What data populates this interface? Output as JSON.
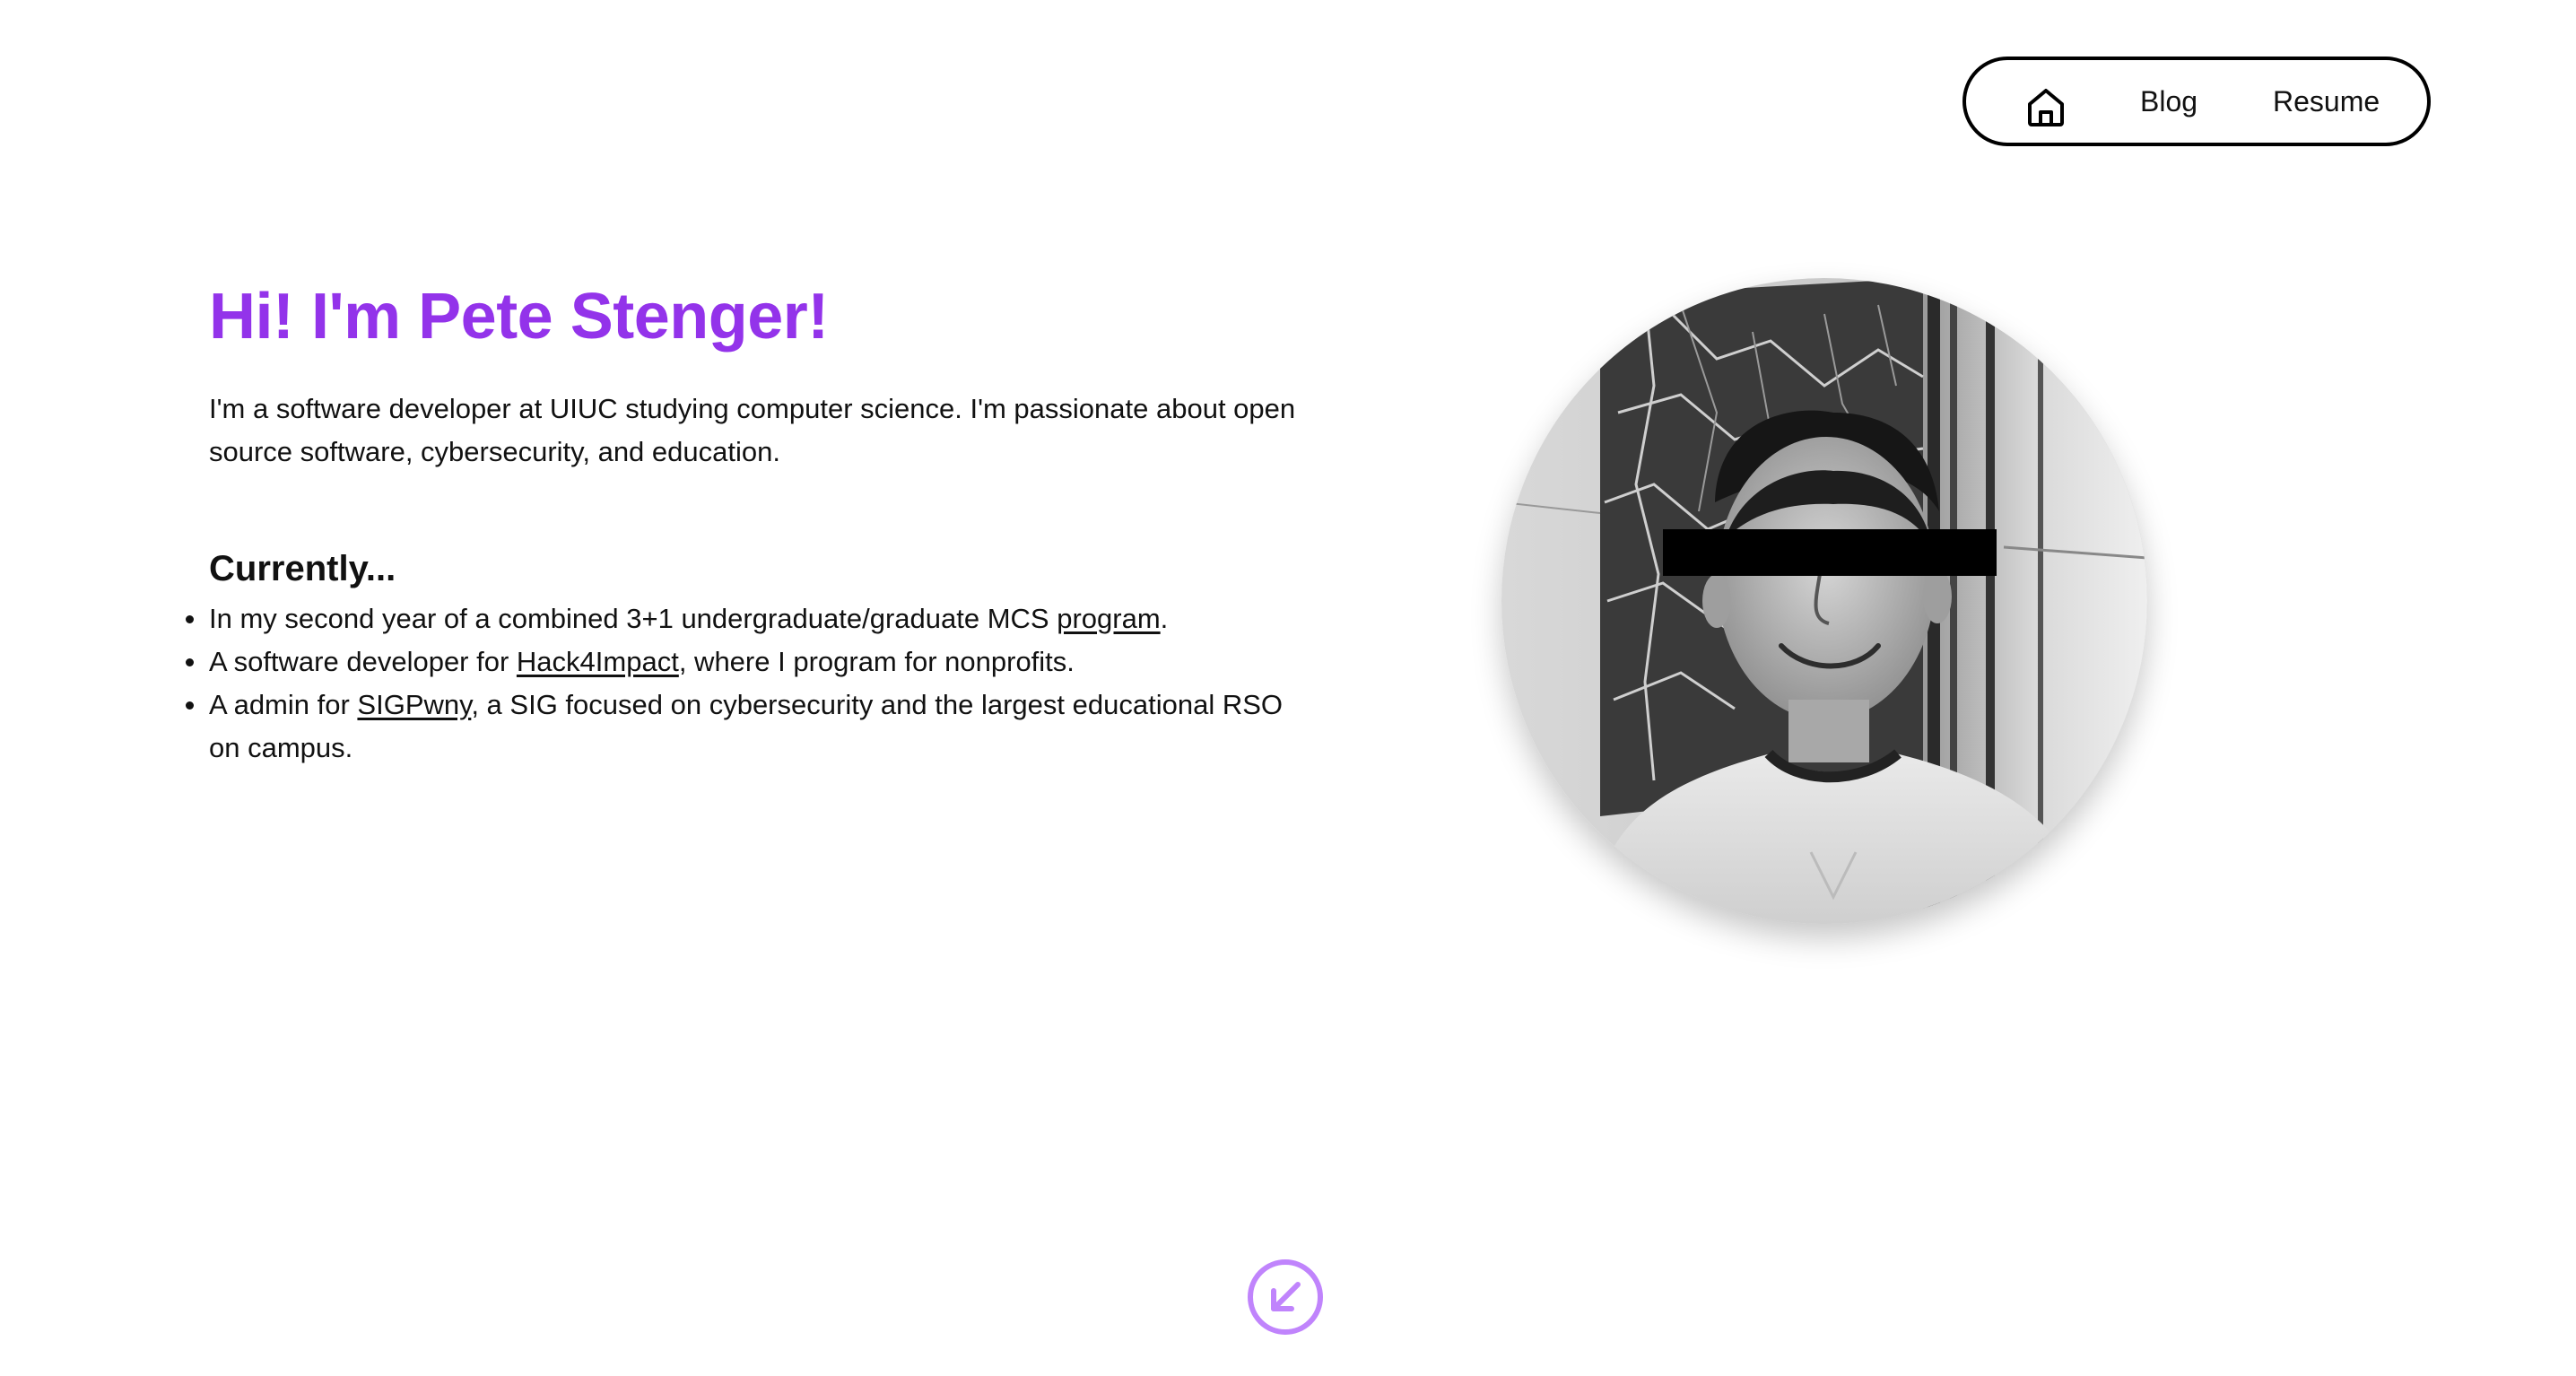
{
  "nav": {
    "home_icon": "home-icon",
    "blog_label": "Blog",
    "resume_label": "Resume"
  },
  "hero": {
    "title": "Hi! I'm Pete Stenger!",
    "intro": "I'm a software developer at UIUC studying computer science. I'm passionate about open source software, cybersecurity, and education."
  },
  "currently": {
    "heading": "Currently...",
    "items": [
      {
        "before": "In my second year of a combined 3+1 undergraduate/graduate MCS ",
        "link": "program",
        "after": "."
      },
      {
        "before": "A software developer for ",
        "link": "Hack4Impact",
        "after": ", where I program for nonprofits."
      },
      {
        "before": "A admin for ",
        "link": "SIGPwny",
        "after": ", a SIG focused on cybersecurity and the largest educational RSO on campus."
      }
    ]
  },
  "portrait": {
    "description_icon": "profile-photo"
  },
  "scroll_button": {
    "icon": "arrow-down-left-circle-icon"
  },
  "colors": {
    "accent": "#9333ea",
    "scroll_icon": "#c084fc",
    "text": "#111111",
    "background": "#ffffff"
  }
}
